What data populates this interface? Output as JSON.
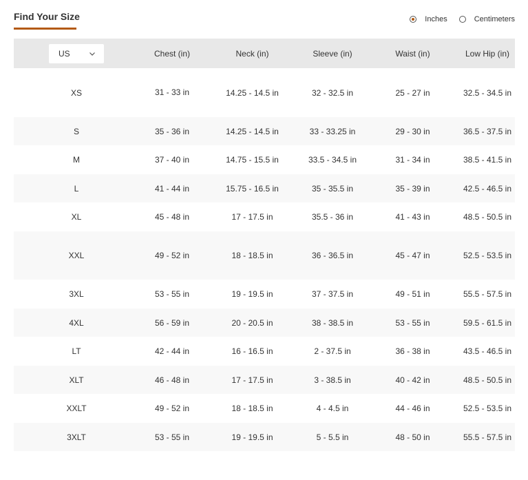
{
  "heading": "Find Your Size",
  "accent_color": "#b35a12",
  "units": {
    "selected": "Inches",
    "options": [
      {
        "label": "Inches",
        "checked": true
      },
      {
        "label": "Centimeters",
        "checked": false
      }
    ]
  },
  "region_select": {
    "value": "US",
    "icon": "chevron-down-icon"
  },
  "columns": [
    "Chest (in)",
    "Neck (in)",
    "Sleeve (in)",
    "Waist (in)",
    "Low Hip (in)"
  ],
  "rows": [
    {
      "size": "XS",
      "chest": "31 - 33 in",
      "neck": "14.25 - 14.5 in",
      "sleeve": "32 - 32.5 in",
      "waist": "25 - 27 in",
      "low_hip": "32.5 - 34.5 in"
    },
    {
      "size": "S",
      "chest": "35 - 36 in",
      "neck": "14.25 - 14.5 in",
      "sleeve": "33 - 33.25 in",
      "waist": "29 - 30 in",
      "low_hip": "36.5 - 37.5 in"
    },
    {
      "size": "M",
      "chest": "37 - 40 in",
      "neck": "14.75 - 15.5 in",
      "sleeve": "33.5 - 34.5 in",
      "waist": "31 - 34 in",
      "low_hip": "38.5 - 41.5 in"
    },
    {
      "size": "L",
      "chest": "41 - 44 in",
      "neck": "15.75 - 16.5 in",
      "sleeve": "35 - 35.5 in",
      "waist": "35 - 39 in",
      "low_hip": "42.5 - 46.5 in"
    },
    {
      "size": "XL",
      "chest": "45 - 48 in",
      "neck": "17 - 17.5 in",
      "sleeve": "35.5 - 36 in",
      "waist": "41 - 43 in",
      "low_hip": "48.5 - 50.5 in"
    },
    {
      "size": "XXL",
      "chest": "49 - 52 in",
      "neck": "18 - 18.5 in",
      "sleeve": "36 - 36.5 in",
      "waist": "45 - 47 in",
      "low_hip": "52.5 - 53.5 in"
    },
    {
      "size": "3XL",
      "chest": "53 - 55 in",
      "neck": "19 - 19.5 in",
      "sleeve": "37 - 37.5 in",
      "waist": "49 - 51 in",
      "low_hip": "55.5 - 57.5 in"
    },
    {
      "size": "4XL",
      "chest": "56 - 59 in",
      "neck": "20 - 20.5 in",
      "sleeve": "38 - 38.5 in",
      "waist": "53 - 55 in",
      "low_hip": "59.5 - 61.5 in"
    },
    {
      "size": "LT",
      "chest": "42 - 44 in",
      "neck": "16 - 16.5 in",
      "sleeve": "2 - 37.5 in",
      "waist": "36 - 38 in",
      "low_hip": "43.5 - 46.5 in"
    },
    {
      "size": "XLT",
      "chest": "46 - 48 in",
      "neck": "17 - 17.5 in",
      "sleeve": "3 - 38.5 in",
      "waist": "40 - 42 in",
      "low_hip": "48.5 - 50.5 in"
    },
    {
      "size": "XXLT",
      "chest": "49 - 52 in",
      "neck": "18 - 18.5 in",
      "sleeve": "4 - 4.5 in",
      "waist": "44 - 46 in",
      "low_hip": "52.5 - 53.5 in"
    },
    {
      "size": "3XLT",
      "chest": "53 - 55 in",
      "neck": "19 - 19.5 in",
      "sleeve": "5 - 5.5 in",
      "waist": "48 - 50 in",
      "low_hip": "55.5 - 57.5 in"
    }
  ]
}
